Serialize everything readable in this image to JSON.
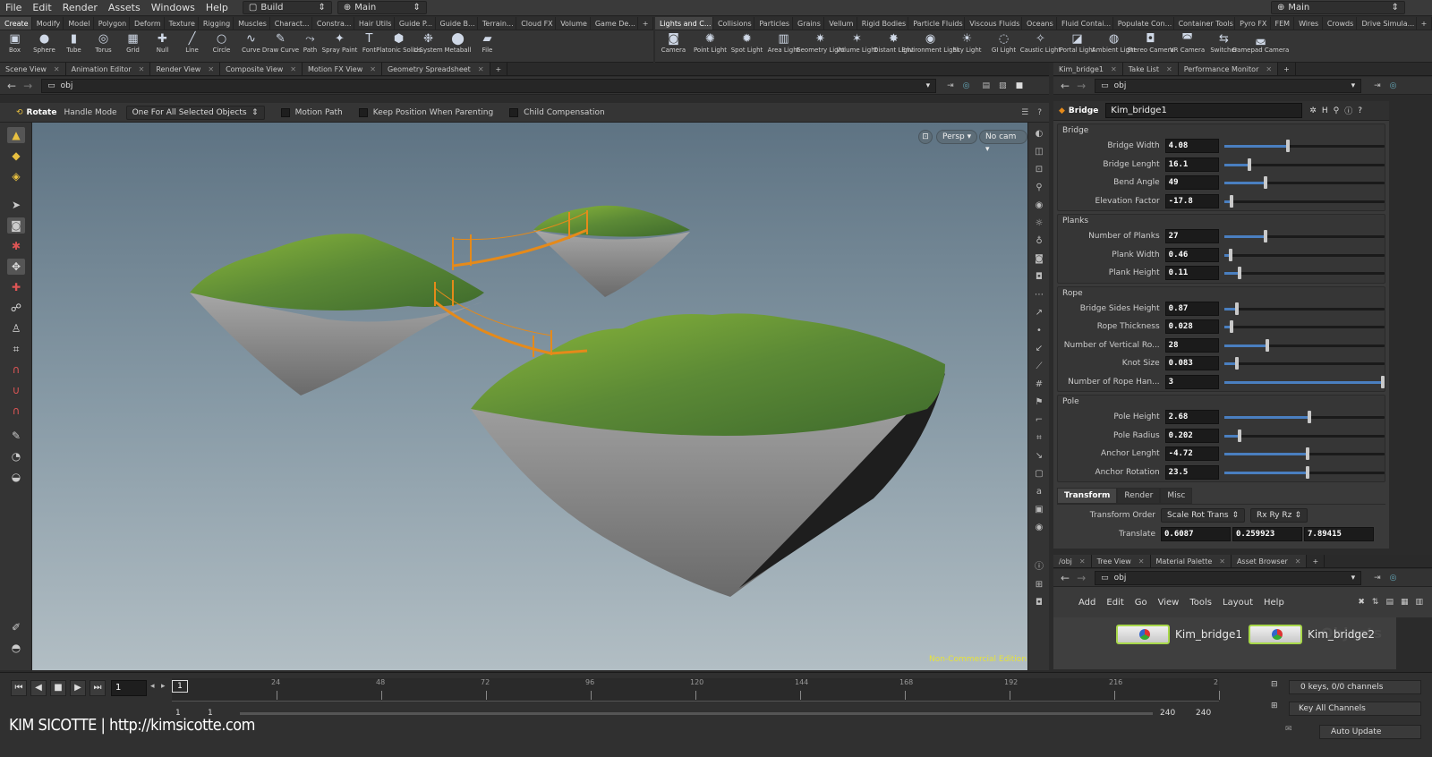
{
  "menubar": {
    "items": [
      "File",
      "Edit",
      "Render",
      "Assets",
      "Windows",
      "Help"
    ],
    "desktop": "Build",
    "context": "Main",
    "right_context": "Main"
  },
  "shelf_left": {
    "tabs": [
      "Create",
      "Modify",
      "Model",
      "Polygon",
      "Deform",
      "Texture",
      "Rigging",
      "Muscles",
      "Charact...",
      "Constra...",
      "Hair Utils",
      "Guide P...",
      "Guide B...",
      "Terrain...",
      "Cloud FX",
      "Volume",
      "Game De..."
    ],
    "tools": [
      {
        "label": "Box",
        "icon": "box-icon",
        "glyph": "▣"
      },
      {
        "label": "Sphere",
        "icon": "sphere-icon",
        "glyph": "●"
      },
      {
        "label": "Tube",
        "icon": "tube-icon",
        "glyph": "▮"
      },
      {
        "label": "Torus",
        "icon": "torus-icon",
        "glyph": "◎"
      },
      {
        "label": "Grid",
        "icon": "grid-icon",
        "glyph": "▦"
      },
      {
        "label": "Null",
        "icon": "null-icon",
        "glyph": "✚"
      },
      {
        "label": "Line",
        "icon": "line-icon",
        "glyph": "╱"
      },
      {
        "label": "Circle",
        "icon": "circle-icon",
        "glyph": "○"
      },
      {
        "label": "Curve",
        "icon": "curve-icon",
        "glyph": "∿"
      },
      {
        "label": "Draw Curve",
        "icon": "draw-curve-icon",
        "glyph": "✎"
      },
      {
        "label": "Path",
        "icon": "path-icon",
        "glyph": "⤳"
      },
      {
        "label": "Spray Paint",
        "icon": "spray-paint-icon",
        "glyph": "✦"
      },
      {
        "label": "Font",
        "icon": "font-icon",
        "glyph": "T"
      },
      {
        "label": "Platonic Solids",
        "icon": "platonic-solids-icon",
        "glyph": "⬢"
      },
      {
        "label": "L-System",
        "icon": "l-system-icon",
        "glyph": "❉"
      },
      {
        "label": "Metaball",
        "icon": "metaball-icon",
        "glyph": "⬤"
      },
      {
        "label": "File",
        "icon": "file-icon",
        "glyph": "▰"
      }
    ]
  },
  "shelf_right": {
    "tabs": [
      "Lights and C...",
      "Collisions",
      "Particles",
      "Grains",
      "Vellum",
      "Rigid Bodies",
      "Particle Fluids",
      "Viscous Fluids",
      "Oceans",
      "Fluid Contai...",
      "Populate Con...",
      "Container Tools",
      "Pyro FX",
      "FEM",
      "Wires",
      "Crowds",
      "Drive Simula..."
    ],
    "tools": [
      {
        "label": "Camera",
        "icon": "camera-icon",
        "glyph": "◙"
      },
      {
        "label": "Point Light",
        "icon": "point-light-icon",
        "glyph": "✺"
      },
      {
        "label": "Spot Light",
        "icon": "spot-light-icon",
        "glyph": "✹"
      },
      {
        "label": "Area Light",
        "icon": "area-light-icon",
        "glyph": "▥"
      },
      {
        "label": "Geometry Light",
        "icon": "geometry-light-icon",
        "glyph": "✷"
      },
      {
        "label": "Volume Light",
        "icon": "volume-light-icon",
        "glyph": "✶"
      },
      {
        "label": "Distant Light",
        "icon": "distant-light-icon",
        "glyph": "✸"
      },
      {
        "label": "Environment Light",
        "icon": "environment-light-icon",
        "glyph": "◉"
      },
      {
        "label": "Sky Light",
        "icon": "sky-light-icon",
        "glyph": "☀"
      },
      {
        "label": "GI Light",
        "icon": "gi-light-icon",
        "glyph": "◌"
      },
      {
        "label": "Caustic Light",
        "icon": "caustic-light-icon",
        "glyph": "✧"
      },
      {
        "label": "Portal Light",
        "icon": "portal-light-icon",
        "glyph": "◪"
      },
      {
        "label": "Ambient Light",
        "icon": "ambient-light-icon",
        "glyph": "◍"
      },
      {
        "label": "Stereo Camera",
        "icon": "stereo-camera-icon",
        "glyph": "◘"
      },
      {
        "label": "VR Camera",
        "icon": "vr-camera-icon",
        "glyph": "◚"
      },
      {
        "label": "Switcher",
        "icon": "switcher-icon",
        "glyph": "⇆"
      },
      {
        "label": "Gamepad Camera",
        "icon": "gamepad-camera-icon",
        "glyph": "◛"
      }
    ]
  },
  "viewer_tabs": [
    "Scene View",
    "Animation Editor",
    "Render View",
    "Composite View",
    "Motion FX View",
    "Geometry Spreadsheet"
  ],
  "viewer_path": "obj",
  "operation": {
    "tool": "Rotate",
    "handle_mode_label": "Handle Mode",
    "handle_mode_value": "One For All Selected Objects",
    "motion_path": "Motion Path",
    "keep_position": "Keep Position When Parenting",
    "child_comp": "Child Compensation"
  },
  "viewport": {
    "persp": "Persp ▾",
    "cam": "No cam ▾",
    "edition": "Non-Commercial Edition"
  },
  "param_tabs": [
    "Kim_bridge1",
    "Take List",
    "Performance Monitor"
  ],
  "param_path": "obj",
  "node": {
    "type": "Bridge",
    "name": "Kim_bridge1"
  },
  "folders": [
    {
      "title": "Bridge",
      "params": [
        {
          "label": "Bridge Width",
          "value": "4.08",
          "frac": 0.4
        },
        {
          "label": "Bridge Lenght",
          "value": "16.1",
          "frac": 0.16
        },
        {
          "label": "Bend Angle",
          "value": "49",
          "frac": 0.26
        },
        {
          "label": "Elevation Factor",
          "value": "-17.8",
          "frac": 0.05
        }
      ]
    },
    {
      "title": "Planks",
      "params": [
        {
          "label": "Number of Planks",
          "value": "27",
          "frac": 0.26
        },
        {
          "label": "Plank Width",
          "value": "0.46",
          "frac": 0.04
        },
        {
          "label": "Plank Height",
          "value": "0.11",
          "frac": 0.1
        }
      ]
    },
    {
      "title": "Rope",
      "params": [
        {
          "label": "Bridge Sides Height",
          "value": "0.87",
          "frac": 0.08
        },
        {
          "label": "Rope Thickness",
          "value": "0.028",
          "frac": 0.05
        },
        {
          "label": "Number of Vertical Ro...",
          "value": "28",
          "frac": 0.27
        },
        {
          "label": "Knot Size",
          "value": "0.083",
          "frac": 0.08
        },
        {
          "label": "Number of Rope Han...",
          "value": "3",
          "frac": 0.99
        }
      ]
    },
    {
      "title": "Pole",
      "params": [
        {
          "label": "Pole Height",
          "value": "2.68",
          "frac": 0.53
        },
        {
          "label": "Pole Radius",
          "value": "0.202",
          "frac": 0.1
        },
        {
          "label": "Anchor Lenght",
          "value": "-4.72",
          "frac": 0.52
        },
        {
          "label": "Anchor Rotation",
          "value": "23.5",
          "frac": 0.52
        }
      ]
    }
  ],
  "xform_tabs": [
    "Transform",
    "Render",
    "Misc"
  ],
  "transform": {
    "order_label": "Transform Order",
    "order_value": "Scale Rot Trans",
    "rot_value": "Rx Ry Rz",
    "translate_label": "Translate",
    "translate": [
      "0.6087",
      "0.259923",
      "7.89415"
    ]
  },
  "network_tabs": [
    "/obj",
    "Tree View",
    "Material Palette",
    "Asset Browser"
  ],
  "network_path": "obj",
  "network_menu": [
    "Add",
    "Edit",
    "Go",
    "View",
    "Tools",
    "Layout",
    "Help"
  ],
  "network_watermark": "Objects",
  "nodes": [
    "Kim_bridge1",
    "Kim_bridge2"
  ],
  "timeline": {
    "frame": "1",
    "marker": "1",
    "ticks": [
      "24",
      "48",
      "72",
      "96",
      "120",
      "144",
      "168",
      "192",
      "216",
      "2"
    ],
    "range_start": "1",
    "range_start2": "1",
    "range_end": "240",
    "range_end2": "240",
    "keys_info": "0 keys, 0/0 channels",
    "key_channels": "Key All Channels",
    "auto_update": "Auto Update"
  },
  "watermark": "KIM SICOTTE | http://kimsicotte.com",
  "colors": {
    "accent": "#4a7fc0",
    "node_border": "#a8d84a",
    "bridge": "#e58a1a"
  }
}
